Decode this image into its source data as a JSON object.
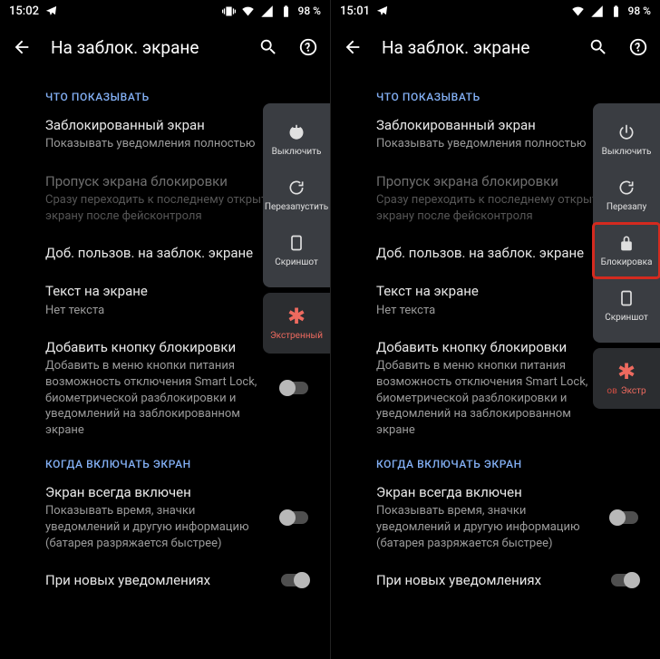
{
  "left": {
    "status": {
      "time": "15:02",
      "battery": "98 %"
    },
    "appbar": {
      "title": "На заблок. экране"
    },
    "section1_header": "ЧТО ПОКАЗЫВАТЬ",
    "items1": {
      "lock_screen": {
        "primary": "Заблокированный экран",
        "secondary": "Показывать уведомления полностью"
      },
      "skip": {
        "primary": "Пропуск экрана блокировки",
        "secondary": "Сразу переходить к последнему открытому экрану после фейсконтроля"
      },
      "add_users": {
        "primary": "Доб. пользов. на заблок. экране"
      },
      "text": {
        "primary": "Текст на экране",
        "secondary": "Нет текста"
      },
      "add_lockdown": {
        "primary": "Добавить кнопку блокировки",
        "secondary": "Добавить в меню кнопки питания возможность отключения Smart Lock, биометрической разблокировки и уведомлений на заблокированном экране"
      }
    },
    "section2_header": "КОГДА ВКЛЮЧАТЬ ЭКРАН",
    "items2": {
      "always_on": {
        "primary": "Экран всегда включен",
        "secondary": "Показывать время, значки уведомлений и другую информацию (батарея разряжается быстрее)"
      },
      "new_notif": {
        "primary": "При новых уведомлениях"
      }
    },
    "power_menu": {
      "power_off": "Выключить",
      "restart": "Перезапустить",
      "screenshot": "Скриншот",
      "emergency": "Экстренный"
    }
  },
  "right": {
    "status": {
      "time": "15:01",
      "battery": "98 %"
    },
    "appbar": {
      "title": "На заблок. экране"
    },
    "section1_header": "ЧТО ПОКАЗЫВАТЬ",
    "items1": {
      "lock_screen": {
        "primary": "Заблокированный экран",
        "secondary": "Показывать уведомления полностью"
      },
      "skip": {
        "primary": "Пропуск экрана блокировки",
        "secondary": "Сразу переходить к последнему открытому экрану после фейсконтроля"
      },
      "add_users": {
        "primary": "Доб. пользов. на заблок. экране"
      },
      "text": {
        "primary": "Текст на экране",
        "secondary": "Нет текста"
      },
      "add_lockdown": {
        "primary": "Добавить кнопку блокировки",
        "secondary": "Добавить в меню кнопки питания возможность отключения Smart Lock, биометрической разблокировки и уведомлений на заблокированном экране"
      }
    },
    "section2_header": "КОГДА ВКЛЮЧАТЬ ЭКРАН",
    "items2": {
      "always_on": {
        "primary": "Экран всегда включен",
        "secondary": "Показывать время, значки уведомлений и другую информацию (батарея разряжается быстрее)"
      },
      "new_notif": {
        "primary": "При новых уведомлениях"
      }
    },
    "power_menu": {
      "power_off": "Выключить",
      "restart": "Перезапу",
      "lockdown": "Блокировка",
      "screenshot": "Скриншот",
      "emergency_prefix": "ов",
      "emergency": "Экстр"
    }
  }
}
